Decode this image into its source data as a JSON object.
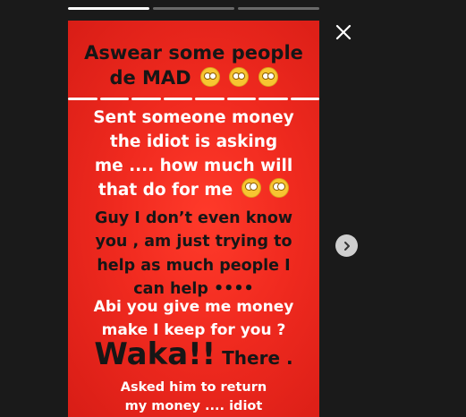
{
  "story": {
    "progress": [
      {
        "filled": 1.0
      },
      {
        "filled": 0.0
      },
      {
        "filled": 0.0
      }
    ],
    "text": {
      "line1": "Aswear some people",
      "line2": "de MAD",
      "white_block": [
        "Sent someone money",
        "the idiot is asking",
        "me .... how much will",
        "that do for me"
      ],
      "black_block": [
        "Guy I don’t even know",
        "you , am just trying to",
        "help as much people I",
        "can help ••••"
      ],
      "white_block2": [
        "Abi you give me money",
        "make I keep for you ?"
      ],
      "waka": "Waka!!",
      "waka_there": " There .",
      "black_end": [
        "Asked him to return",
        "my money .... idiot"
      ]
    },
    "colors": {
      "background": "#ef2b1e",
      "text_black": "#161616",
      "text_white": "#ffffff"
    }
  },
  "controls": {
    "close_icon": "close-icon",
    "next_icon": "chevron-right-icon"
  }
}
